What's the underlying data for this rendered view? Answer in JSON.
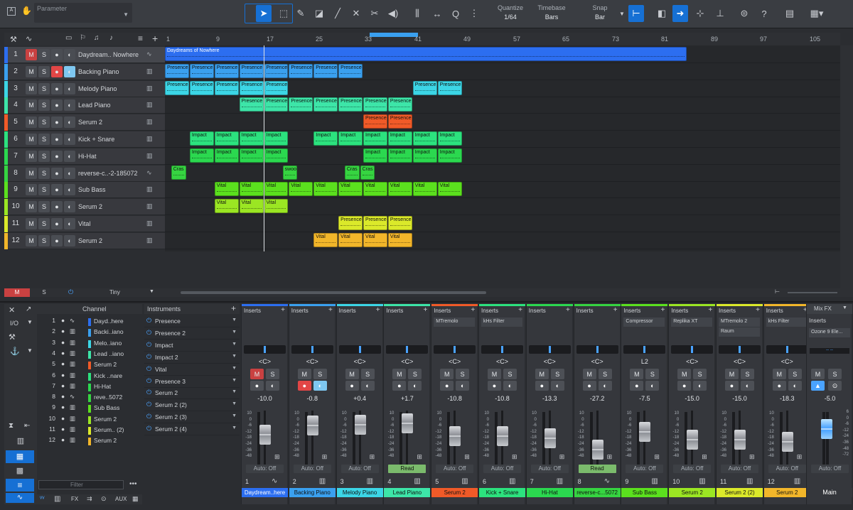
{
  "toolbar": {
    "parameter_label": "Parameter",
    "quantize_label": "Quantize",
    "quantize_value": "1/64",
    "timebase_label": "Timebase",
    "timebase_value": "Bars",
    "snap_label": "Snap",
    "snap_value": "Bar"
  },
  "ruler": {
    "ticks": [
      "1",
      "9",
      "17",
      "25",
      "33",
      "41",
      "49",
      "57",
      "65",
      "73",
      "81",
      "89",
      "97",
      "105"
    ]
  },
  "tracks": [
    {
      "num": "1",
      "name": "Daydream.. Nowhere",
      "color": "#2c6ef0",
      "mute_active": true,
      "rec": false
    },
    {
      "num": "2",
      "name": "Backing Piano",
      "color": "#3aa0ef",
      "mute_active": false,
      "rec": true
    },
    {
      "num": "3",
      "name": "Melody Piano",
      "color": "#3cd6e6",
      "mute_active": false,
      "rec": false
    },
    {
      "num": "4",
      "name": "Lead Piano",
      "color": "#3de5a8",
      "mute_active": false,
      "rec": false
    },
    {
      "num": "5",
      "name": "Serum 2",
      "color": "#f05a28",
      "mute_active": false,
      "rec": false
    },
    {
      "num": "6",
      "name": "Kick + Snare",
      "color": "#2ce27e",
      "mute_active": false,
      "rec": false
    },
    {
      "num": "7",
      "name": "Hi-Hat",
      "color": "#2bd84f",
      "mute_active": false,
      "rec": false
    },
    {
      "num": "8",
      "name": "reverse-c..-2-185072",
      "color": "#36d441",
      "mute_active": false,
      "rec": false
    },
    {
      "num": "9",
      "name": "Sub Bass",
      "color": "#5be01e",
      "mute_active": false,
      "rec": false
    },
    {
      "num": "10",
      "name": "Serum 2",
      "color": "#9be623",
      "mute_active": false,
      "rec": false
    },
    {
      "num": "11",
      "name": "Vital",
      "color": "#dbe92a",
      "mute_active": false,
      "rec": false
    },
    {
      "num": "12",
      "name": "Serum 2",
      "color": "#f2b62a",
      "mute_active": false,
      "rec": false
    }
  ],
  "arrange_clips": {
    "audio_clip_label": "Daydreams of Nowhere",
    "presence": "Presence",
    "impact": "Impact",
    "vital": "Vital",
    "cras": "Cras",
    "swoo": "swoo"
  },
  "header_bottom": {
    "m": "M",
    "s": "S",
    "tiny": "Tiny"
  },
  "browser": {
    "channel_header": "Channel",
    "instruments_header": "Instruments",
    "io_label": "I/O",
    "filter_placeholder": "Filter",
    "tabs": [
      "FX",
      "AUX"
    ],
    "channels": [
      {
        "n": "1",
        "name": "Dayd..here",
        "color": "#2c6ef0"
      },
      {
        "n": "2",
        "name": "Backi..iano",
        "color": "#3aa0ef"
      },
      {
        "n": "3",
        "name": "Melo..iano",
        "color": "#3cd6e6"
      },
      {
        "n": "4",
        "name": "Lead ..iano",
        "color": "#3de5a8"
      },
      {
        "n": "5",
        "name": "Serum 2",
        "color": "#f05a28"
      },
      {
        "n": "6",
        "name": "Kick ..nare",
        "color": "#2ce27e"
      },
      {
        "n": "7",
        "name": "Hi-Hat",
        "color": "#2bd84f"
      },
      {
        "n": "8",
        "name": "reve..5072",
        "color": "#36d441"
      },
      {
        "n": "9",
        "name": "Sub Bass",
        "color": "#5be01e"
      },
      {
        "n": "10",
        "name": "Serum 2",
        "color": "#9be623"
      },
      {
        "n": "11",
        "name": "Serum.. (2)",
        "color": "#dbe92a"
      },
      {
        "n": "12",
        "name": "Serum 2",
        "color": "#f2b62a"
      }
    ],
    "instruments": [
      "Presence",
      "Presence 2",
      "Impact",
      "Impact 2",
      "Vital",
      "Presence 3",
      "Serum 2",
      "Serum 2 (2)",
      "Serum 2 (3)",
      "Serum 2 (4)"
    ]
  },
  "mixer": {
    "inserts_label": "Inserts",
    "pan_label": "<C>",
    "m": "M",
    "s": "S",
    "scale": [
      "10",
      "0",
      "-6",
      "-12",
      "-18",
      "-24",
      "-36",
      "-48"
    ],
    "channels": [
      {
        "num": "1",
        "name": "Daydream..here",
        "color": "#2c6ef0",
        "vol": "-10.0",
        "pan": "<C>",
        "insert": "",
        "auto": "Auto: Off",
        "fader": 0.55,
        "mute": true,
        "rec": false
      },
      {
        "num": "2",
        "name": "Backing Piano",
        "color": "#3aa0ef",
        "vol": "-0.8",
        "pan": "<C>",
        "insert": "",
        "auto": "Auto: Off",
        "fader": 0.72,
        "mute": false,
        "rec": true
      },
      {
        "num": "3",
        "name": "Melody Piano",
        "color": "#3cd6e6",
        "vol": "+0.4",
        "pan": "<C>",
        "insert": "",
        "auto": "Auto: Off",
        "fader": 0.74,
        "mute": false,
        "rec": false
      },
      {
        "num": "4",
        "name": "Lead Piano",
        "color": "#3de5a8",
        "vol": "+1.7",
        "pan": "<C>",
        "insert": "",
        "auto": "Read",
        "fader": 0.76,
        "mute": false,
        "rec": false
      },
      {
        "num": "5",
        "name": "Serum 2",
        "color": "#f05a28",
        "vol": "-10.8",
        "pan": "<C>",
        "insert": "MTremolo",
        "auto": "Auto: Off",
        "fader": 0.53,
        "mute": false,
        "rec": false
      },
      {
        "num": "6",
        "name": "Kick + Snare",
        "color": "#2ce27e",
        "vol": "-10.8",
        "pan": "<C>",
        "insert": "kHs Filter",
        "auto": "Auto: Off",
        "fader": 0.53,
        "mute": false,
        "rec": false
      },
      {
        "num": "7",
        "name": "Hi-Hat",
        "color": "#2bd84f",
        "vol": "-13.3",
        "pan": "<C>",
        "insert": "",
        "auto": "Auto: Off",
        "fader": 0.49,
        "mute": false,
        "rec": false
      },
      {
        "num": "8",
        "name": "reverse-c...5072",
        "color": "#36d441",
        "vol": "-27.2",
        "pan": "<C>",
        "insert": "",
        "auto": "Read",
        "fader": 0.28,
        "mute": false,
        "rec": false
      },
      {
        "num": "9",
        "name": "Sub Bass",
        "color": "#5be01e",
        "vol": "-7.5",
        "pan": "L2",
        "insert": "Compressor",
        "auto": "Auto: Off",
        "fader": 0.6,
        "mute": false,
        "rec": false
      },
      {
        "num": "10",
        "name": "Serum 2",
        "color": "#9be623",
        "vol": "-15.0",
        "pan": "<C>",
        "insert": "Replika XT",
        "auto": "Auto: Off",
        "fader": 0.46,
        "mute": false,
        "rec": false
      },
      {
        "num": "11",
        "name": "Serum 2 (2)",
        "color": "#dbe92a",
        "vol": "-15.0",
        "pan": "<C>",
        "insert": "MTremolo 2",
        "insert2": "Raum",
        "auto": "Auto: Off",
        "fader": 0.46,
        "mute": false,
        "rec": false
      },
      {
        "num": "12",
        "name": "Serum 2",
        "color": "#f2b62a",
        "vol": "-18.3",
        "pan": "<C>",
        "insert": "kHs Filter",
        "auto": "Auto: Off",
        "fader": 0.42,
        "mute": false,
        "rec": false
      }
    ],
    "main": {
      "name": "Main",
      "vol": "-5.0",
      "fx_label": "Mix FX",
      "insert": "Ozone 9 Ele...",
      "auto": "Auto: Off",
      "fader": 0.66,
      "scale": [
        "6",
        "0",
        "-6",
        "-12",
        "-24",
        "-36",
        "-48",
        "-72"
      ]
    }
  }
}
